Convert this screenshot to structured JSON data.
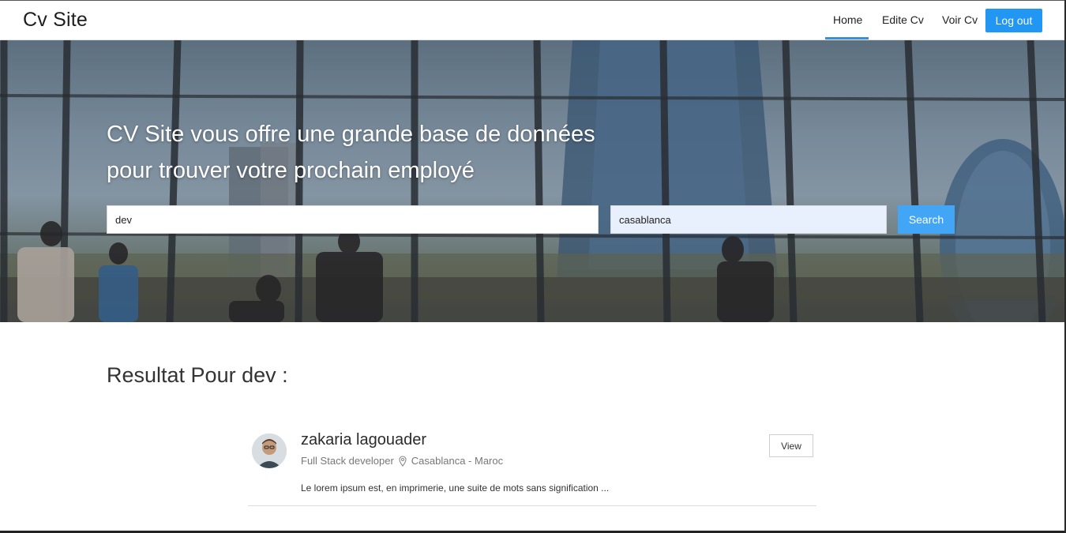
{
  "navbar": {
    "brand": "Cv Site",
    "links": [
      {
        "label": "Home",
        "active": true
      },
      {
        "label": "Edite Cv",
        "active": false
      },
      {
        "label": "Voir Cv",
        "active": false
      }
    ],
    "logout_label": "Log out",
    "accent_color": "#2196f3"
  },
  "hero": {
    "title": "CV Site vous offre une grande base de données pour trouver votre prochain employé",
    "search": {
      "keyword_value": "dev",
      "city_value": "casablanca",
      "button_label": "Search"
    }
  },
  "results": {
    "heading": "Resultat Pour dev :",
    "items": [
      {
        "name": "zakaria lagouader",
        "title": "Full Stack developer",
        "location_icon": "map-pin-icon",
        "location": "Casablanca - Maroc",
        "description": "Le lorem ipsum est, en imprimerie, une suite de mots sans signification ...",
        "view_label": "View"
      }
    ]
  }
}
